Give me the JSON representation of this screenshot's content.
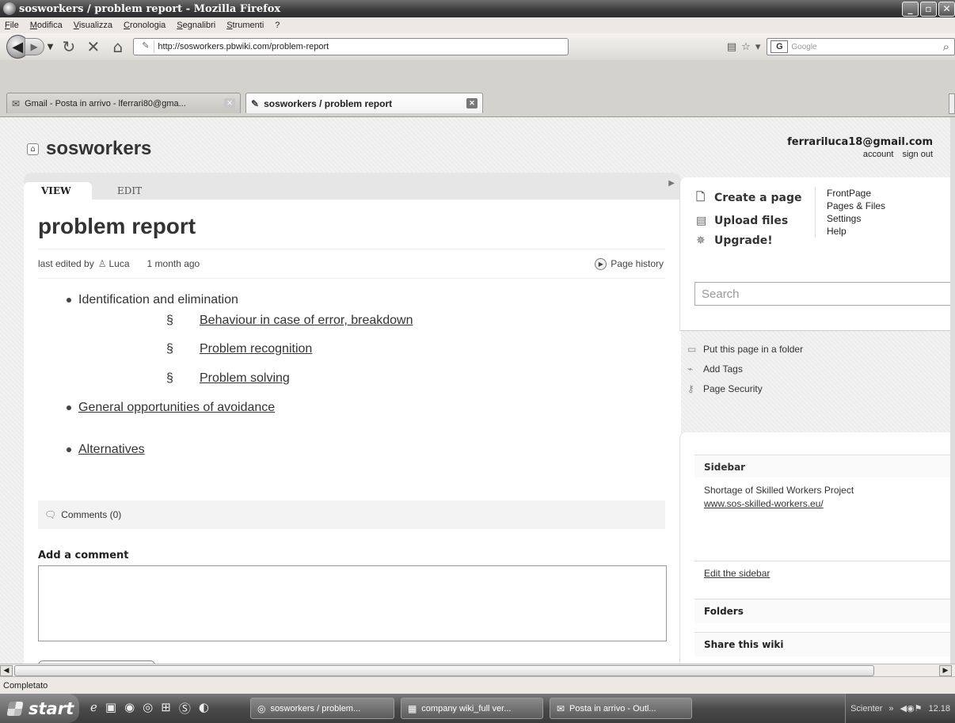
{
  "window": {
    "title": "sosworkers / problem report - Mozilla Firefox",
    "buttons": [
      "_",
      "▫",
      "✕"
    ]
  },
  "menu": [
    "File",
    "Modifica",
    "Visualizza",
    "Cronologia",
    "Segnalibri",
    "Strumenti",
    "?"
  ],
  "nav": {
    "url": "http://sosworkers.pbwiki.com/problem-report",
    "search_placeholder": "Google"
  },
  "tabs": [
    {
      "label": "Gmail - Posta in arrivo - lferrari80@gma...",
      "icon": "gmail-icon"
    },
    {
      "label": "sosworkers / problem report",
      "icon": "pbwiki-icon"
    }
  ],
  "site": {
    "name": "sosworkers",
    "user_email": "ferrariluca18@gmail.com",
    "account_link": "account",
    "signout_link": "sign out"
  },
  "page": {
    "tab_view": "VIEW",
    "tab_edit": "EDIT",
    "title": "problem report",
    "edited_prefix": "last edited by",
    "editor": "Luca",
    "edited_ago": "1 month ago",
    "history": "Page history",
    "items": [
      {
        "text": "Identification and elimination"
      },
      {
        "text": "Behaviour in case of error, breakdown"
      },
      {
        "text": "Problem recognition"
      },
      {
        "text": "Problem solving"
      },
      {
        "text": "General opportunities of avoidance"
      },
      {
        "text": "Alternatives"
      }
    ],
    "section_mark": "§",
    "comments": "Comments (0)",
    "add_comment": "Add a comment"
  },
  "right": {
    "actions": [
      "Create a page",
      "Upload files",
      "Upgrade!"
    ],
    "quicklinks": [
      "FrontPage",
      "Pages & Files",
      "Settings",
      "Help"
    ],
    "search_placeholder": "Search",
    "page_tools": [
      "Put this page in a folder",
      "Add Tags",
      "Page Security"
    ],
    "sidebar_title": "Sidebar",
    "sidebar_text": "Shortage of Skilled Workers Project",
    "sidebar_link": "www.sos-skilled-workers.eu/",
    "edit_sidebar": "Edit the sidebar",
    "folders": "Folders",
    "share": "Share this wiki"
  },
  "status": "Completato",
  "taskbar": {
    "start": "start",
    "tasks": [
      "sosworkers / problem...",
      "company wiki_full ver...",
      "Posta in arrivo - Outl..."
    ],
    "tray_text": "Scienter",
    "clock": "12.18"
  }
}
